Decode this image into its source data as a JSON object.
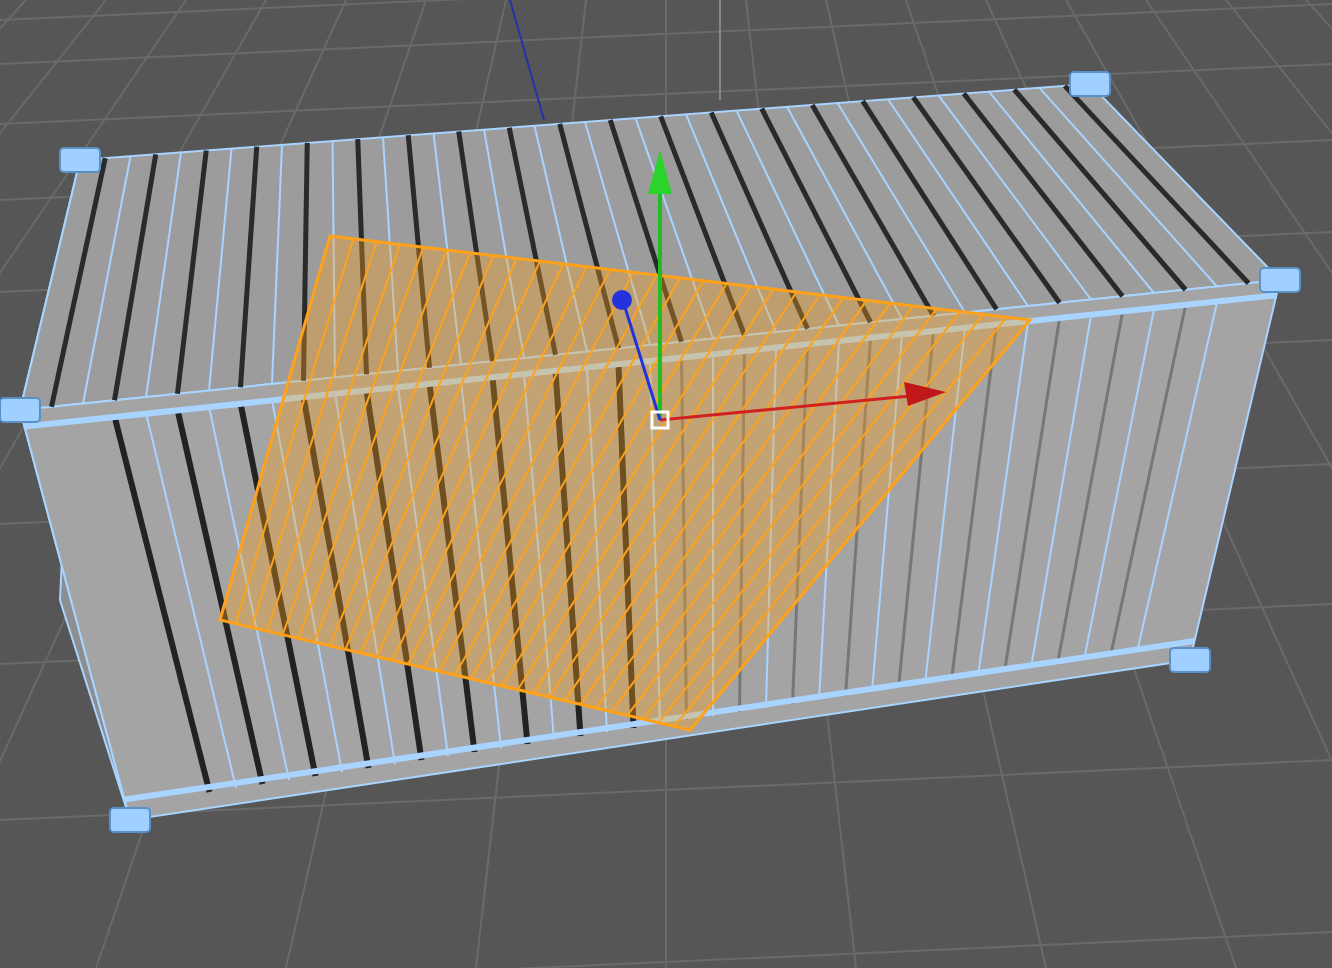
{
  "viewport": {
    "objects": [
      {
        "kind": "container",
        "selected": true
      },
      {
        "kind": "plane",
        "selected": true
      }
    ]
  }
}
